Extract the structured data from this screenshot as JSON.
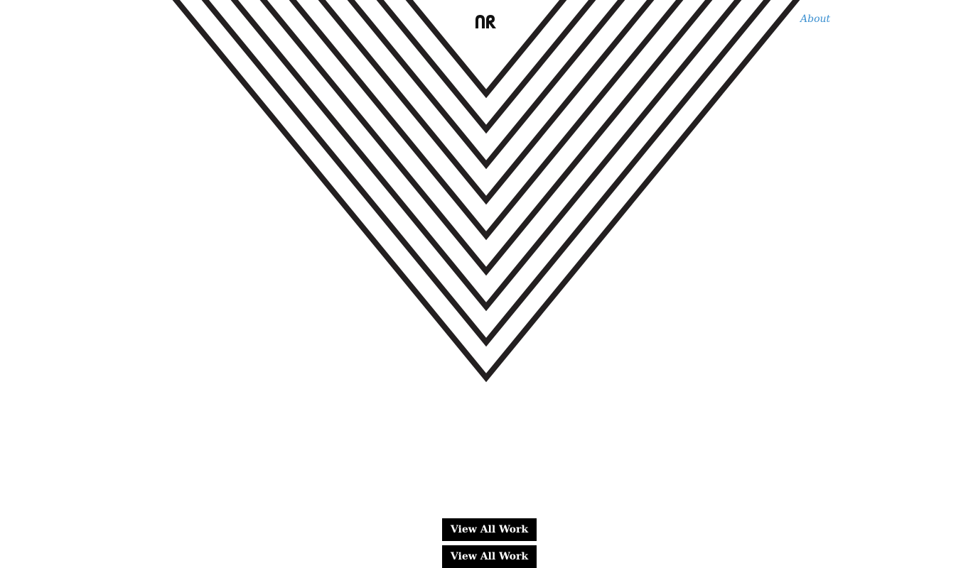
{
  "header": {
    "logo_icon": "monogram-logo-icon",
    "about_label": "About"
  },
  "hero": {
    "graphic": "nested-chevron-stripes",
    "stripe_count": 9,
    "stripe_color": "#231f20"
  },
  "actions": {
    "view_all_work_label": "View All Work",
    "view_all_work_label_2": "View All Work"
  },
  "colors": {
    "background": "#ffffff",
    "link": "#3a8fd0",
    "button_bg": "#000000",
    "button_text": "#ffffff",
    "logo": "#111111"
  }
}
